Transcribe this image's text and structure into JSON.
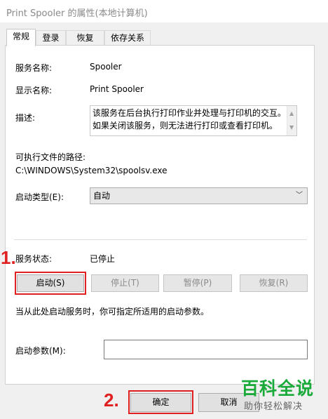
{
  "window": {
    "title": "Print Spooler 的属性(本地计算机)"
  },
  "tabs": [
    {
      "label": "常规",
      "active": true
    },
    {
      "label": "登录"
    },
    {
      "label": "恢复"
    },
    {
      "label": "依存关系"
    }
  ],
  "general": {
    "service_name_label": "服务名称:",
    "service_name_value": "Spooler",
    "display_name_label": "显示名称:",
    "display_name_value": "Print Spooler",
    "description_label": "描述:",
    "description_value": "该服务在后台执行打印作业并处理与打印机的交互。如果关闭该服务，则无法进行打印或查看打印机。",
    "exe_path_label": "可执行文件的路径:",
    "exe_path_value": "C:\\WINDOWS\\System32\\spoolsv.exe",
    "startup_type_label": "启动类型(E):",
    "startup_type_value": "自动",
    "status_label": "服务状态:",
    "status_value": "已停止",
    "hint_text": "当从此处启动服务时，你可指定所适用的启动参数。",
    "params_label": "启动参数(M):",
    "params_value": ""
  },
  "buttons": {
    "start": "启动(S)",
    "stop": "停止(T)",
    "pause": "暂停(P)",
    "resume": "恢复(R)",
    "ok": "确定",
    "cancel": "取消"
  },
  "annotations": {
    "step1": "1.",
    "step2": "2."
  },
  "watermark": {
    "title": "百科全说",
    "subtitle": "助你轻松解决"
  },
  "colors": {
    "annotation_red": "#e02020",
    "watermark_green": "#1aaa3a"
  }
}
